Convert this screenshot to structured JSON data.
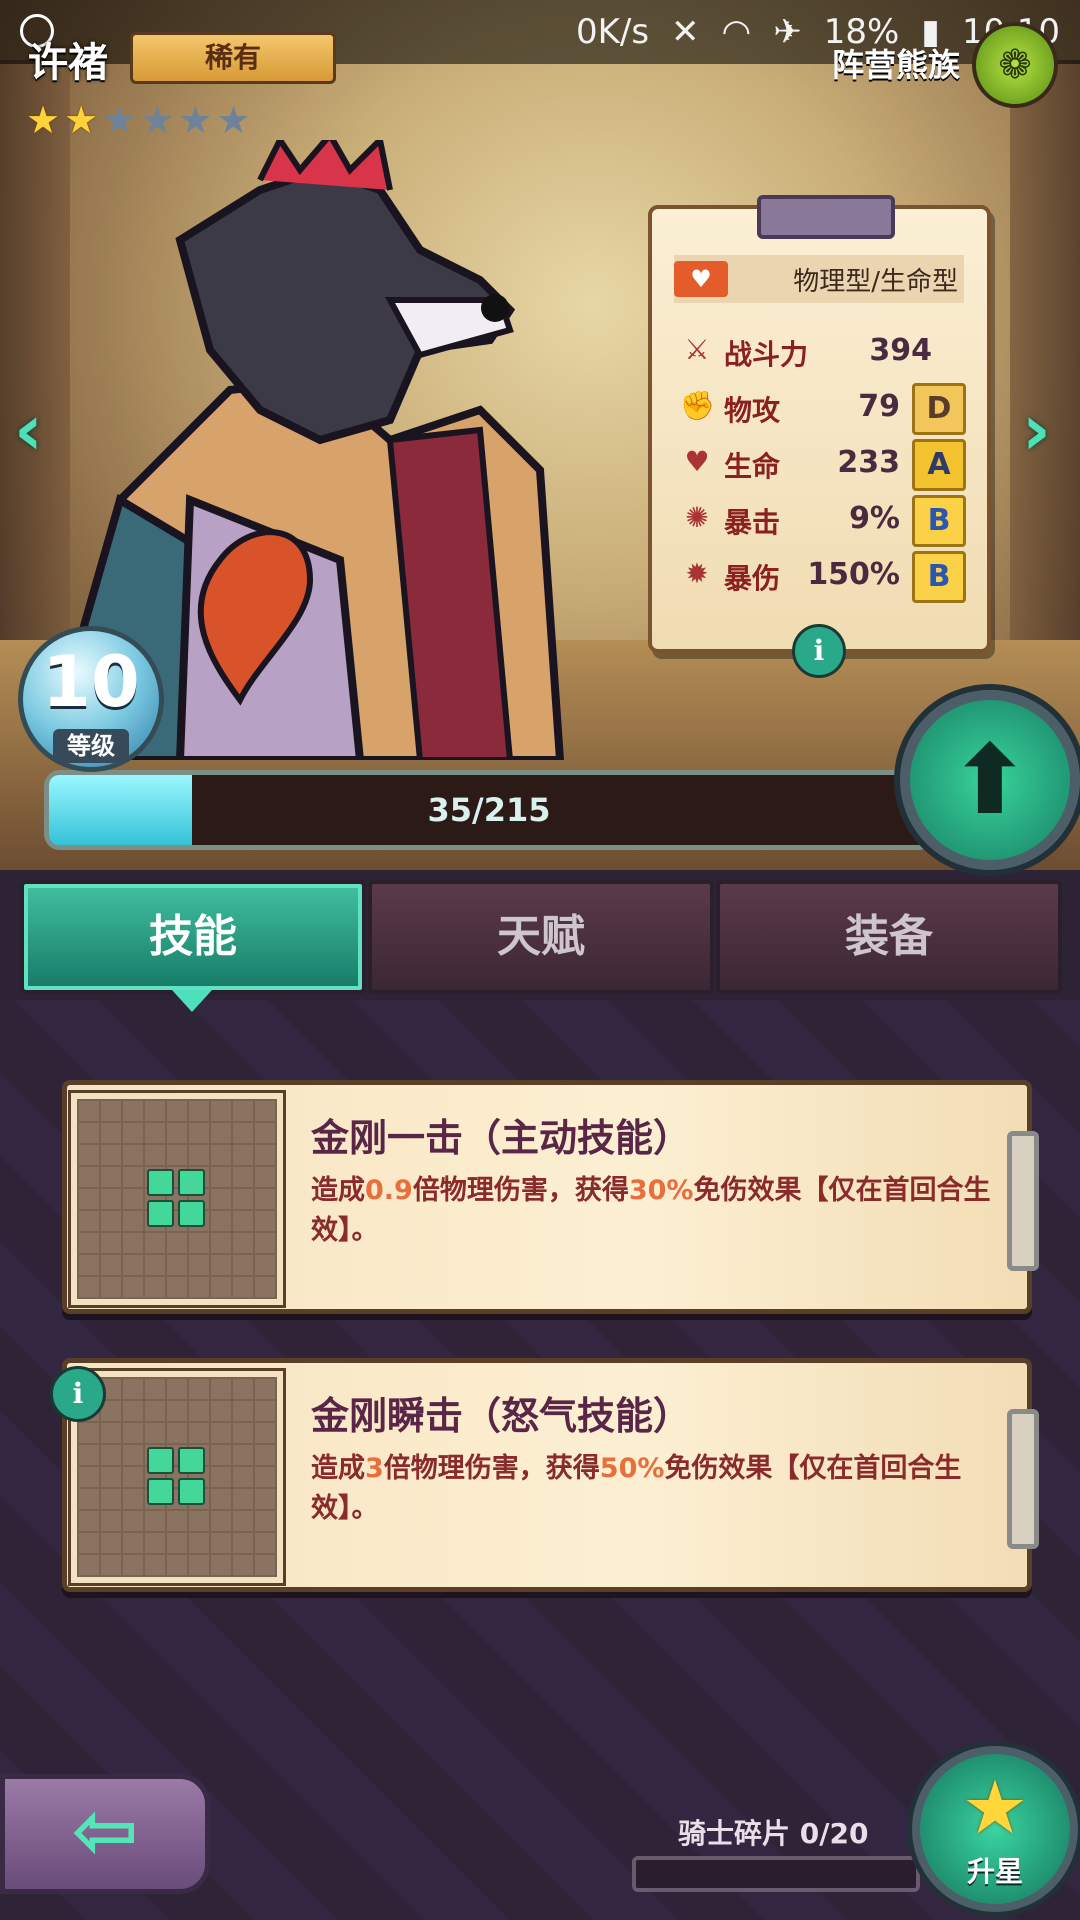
{
  "status_bar": {
    "net_speed": "0K/s",
    "battery": "18%",
    "time": "10:10"
  },
  "hero": {
    "name": "许褚",
    "rarity": "稀有",
    "stars_filled": 2,
    "stars_total": 6,
    "faction": "阵营熊族",
    "faction_icon": "paw-icon"
  },
  "stats": {
    "type": "物理型/生命型",
    "rows": [
      {
        "label": "战斗力",
        "value": "394",
        "grade": ""
      },
      {
        "label": "物攻",
        "value": "79",
        "grade": "D"
      },
      {
        "label": "生命",
        "value": "233",
        "grade": "A"
      },
      {
        "label": "暴击",
        "value": "9%",
        "grade": "B"
      },
      {
        "label": "暴伤",
        "value": "150%",
        "grade": "B"
      }
    ]
  },
  "level": {
    "value": "10",
    "label": "等级",
    "xp_text": "35/215",
    "xp_fraction": 0.163
  },
  "tabs": [
    {
      "label": "技能",
      "active": true
    },
    {
      "label": "天赋",
      "active": false
    },
    {
      "label": "装备",
      "active": false
    }
  ],
  "skills": [
    {
      "title": "金刚一击（主动技能）",
      "desc_parts": [
        "造成",
        "0.9",
        "倍物理伤害，获得",
        "30%",
        "免伤效果【仅在首回合生效】。"
      ]
    },
    {
      "title": "金刚瞬击（怒气技能）",
      "desc_parts": [
        "造成",
        "3",
        "倍物理伤害，获得",
        "50%",
        "免伤效果【仅在首回合生效】。"
      ]
    }
  ],
  "bottom": {
    "shards_label": "骑士碎片 0/20",
    "shards_fraction": 0,
    "star_up_label": "升星"
  },
  "colors": {
    "accent": "#41c0a0",
    "highlight": "#e86e3c",
    "star_on": "#ffd23a"
  }
}
